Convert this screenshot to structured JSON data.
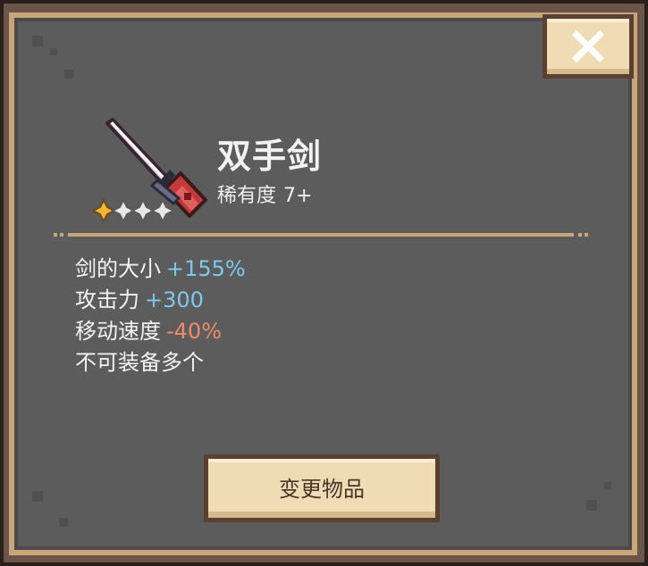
{
  "item": {
    "name": "双手剑",
    "rarity_label": "稀有度",
    "rarity_value": "7+",
    "stars": [
      "gold",
      "silver",
      "silver",
      "silver"
    ]
  },
  "stats": [
    {
      "label": "剑的大小",
      "value": "+155%",
      "kind": "positive"
    },
    {
      "label": "攻击力",
      "value": "+300",
      "kind": "positive"
    },
    {
      "label": "移动速度",
      "value": "-40%",
      "kind": "negative"
    },
    {
      "label": "不可装备多个",
      "value": "",
      "kind": "note"
    }
  ],
  "buttons": {
    "change_label": "变更物品",
    "close_icon": "close-icon"
  },
  "colors": {
    "panel": "#5c5c5c",
    "border": "#c9a57a",
    "button": "#f0dcb4",
    "positive": "#7ec8ec",
    "negative": "#f08a6a"
  }
}
